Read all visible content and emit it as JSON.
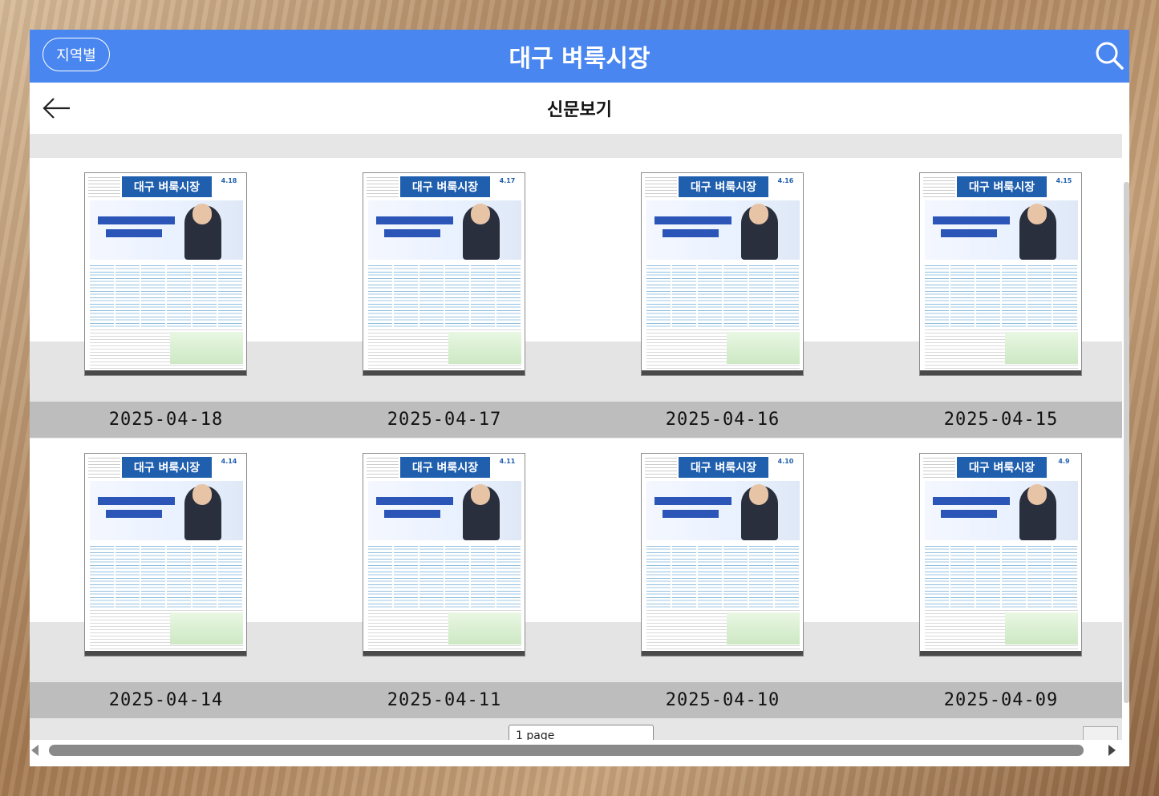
{
  "header": {
    "region_button": "지역별",
    "title": "대구 벼룩시장",
    "search_icon": "search-icon"
  },
  "subheader": {
    "back_icon": "arrow-left-icon",
    "title": "신문보기"
  },
  "newspapers": [
    {
      "masthead": "대구 벼룩시장",
      "date": "2025-04-18",
      "issue": "4.18"
    },
    {
      "masthead": "대구 벼룩시장",
      "date": "2025-04-17",
      "issue": "4.17"
    },
    {
      "masthead": "대구 벼룩시장",
      "date": "2025-04-16",
      "issue": "4.16"
    },
    {
      "masthead": "대구 벼룩시장",
      "date": "2025-04-15",
      "issue": "4.15"
    },
    {
      "masthead": "대구 벼룩시장",
      "date": "2025-04-14",
      "issue": "4.14"
    },
    {
      "masthead": "대구 벼룩시장",
      "date": "2025-04-11",
      "issue": "4.11"
    },
    {
      "masthead": "대구 벼룩시장",
      "date": "2025-04-10",
      "issue": "4.10"
    },
    {
      "masthead": "대구 벼룩시장",
      "date": "2025-04-09",
      "issue": "4.9"
    }
  ],
  "pagination": {
    "select_value": "1 page"
  },
  "colors": {
    "header_blue": "#4a86f0",
    "masthead_blue": "#1f5fae",
    "label_band": "#bdbdbd"
  }
}
